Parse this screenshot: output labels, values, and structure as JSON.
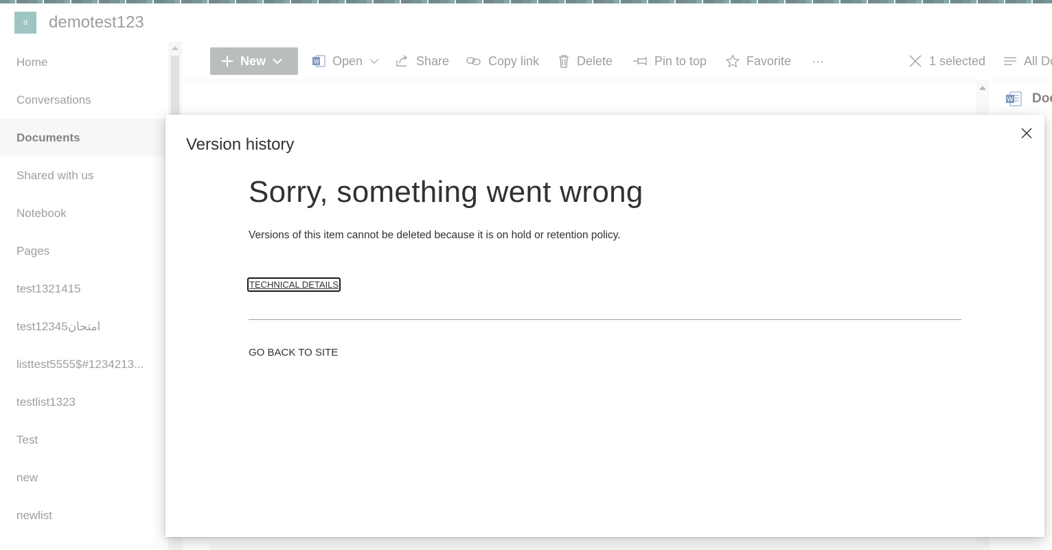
{
  "site": {
    "logo_letter": "d",
    "title": "demotest123"
  },
  "nav": {
    "items": [
      {
        "label": "Home"
      },
      {
        "label": "Conversations"
      },
      {
        "label": "Documents"
      },
      {
        "label": "Shared with us"
      },
      {
        "label": "Notebook"
      },
      {
        "label": "Pages"
      },
      {
        "label": "test1321415"
      },
      {
        "label": "test12345امتحان"
      },
      {
        "label": "listtest5555$#1234213..."
      },
      {
        "label": "testlist1323"
      },
      {
        "label": "Test"
      },
      {
        "label": "new"
      },
      {
        "label": "newlist"
      }
    ],
    "active": "Documents"
  },
  "command_bar": {
    "new_label": "New",
    "open_label": "Open",
    "share_label": "Share",
    "copy_link_label": "Copy link",
    "delete_label": "Delete",
    "pin_label": "Pin to top",
    "favorite_label": "Favorite",
    "more_label": "···",
    "selected_label": "1 selected",
    "view_label": "All Do"
  },
  "details": {
    "title": "Doc"
  },
  "modal": {
    "title": "Version history",
    "heading": "Sorry, something went wrong",
    "message": "Versions of this item cannot be deleted because it is on hold or retention policy.",
    "technical_details_label": "TECHNICAL DETAILS",
    "go_back_label": "GO BACK TO SITE"
  },
  "colors": {
    "accent_gray": "#8a9192",
    "logo_teal": "#5f9f9c"
  }
}
